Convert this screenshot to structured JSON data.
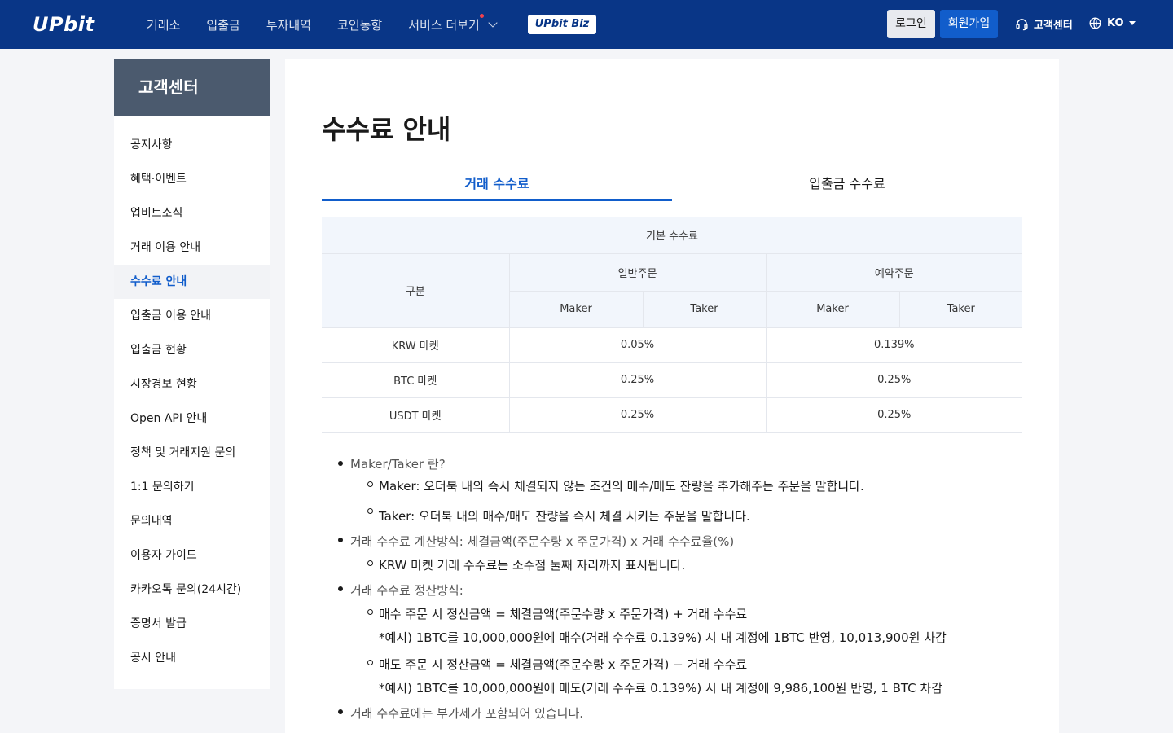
{
  "header": {
    "logo": "UPbit",
    "nav": [
      {
        "label": "거래소"
      },
      {
        "label": "입출금"
      },
      {
        "label": "투자내역"
      },
      {
        "label": "코인동향"
      },
      {
        "label": "서비스 더보기"
      }
    ],
    "biz_badge": "UPbit Biz",
    "login": "로그인",
    "signup": "회원가입",
    "customer_center": "고객센터",
    "language": "KO",
    "colors": {
      "header_bg": "#093687",
      "accent": "#115dcb",
      "new_dot": "#f0414e"
    }
  },
  "sidebar": {
    "title": "고객센터",
    "items": [
      {
        "label": "공지사항"
      },
      {
        "label": "혜택·이벤트"
      },
      {
        "label": "업비트소식"
      },
      {
        "label": "거래 이용 안내"
      },
      {
        "label": "수수료 안내",
        "active": true
      },
      {
        "label": "입출금 이용 안내"
      },
      {
        "label": "입출금 현황"
      },
      {
        "label": "시장경보 현황"
      },
      {
        "label": "Open API 안내"
      },
      {
        "label": "정책 및 거래지원 문의"
      },
      {
        "label": "1:1 문의하기"
      },
      {
        "label": "문의내역"
      },
      {
        "label": "이용자 가이드"
      },
      {
        "label": "카카오톡 문의(24시간)"
      },
      {
        "label": "증명서 발급"
      },
      {
        "label": "공시 안내"
      }
    ]
  },
  "main": {
    "title": "수수료 안내",
    "tabs": [
      {
        "label": "거래 수수료",
        "active": true
      },
      {
        "label": "입출금 수수료"
      }
    ],
    "table": {
      "caption": "기본 수수료",
      "row_header": "구분",
      "group_normal": "일반주문",
      "group_reserved": "예약주문",
      "maker": "Maker",
      "taker": "Taker",
      "rows": [
        {
          "market": "KRW 마켓",
          "normal": "0.05%",
          "reserved": "0.139%"
        },
        {
          "market": "BTC 마켓",
          "normal": "0.25%",
          "reserved": "0.25%"
        },
        {
          "market": "USDT 마켓",
          "normal": "0.25%",
          "reserved": "0.25%"
        }
      ]
    },
    "notes": {
      "maker_taker_title": "Maker/Taker 란?",
      "maker_desc": "Maker: 오더북 내의 즉시 체결되지 않는 조건의 매수/매도 잔량을 추가해주는 주문을 말합니다.",
      "taker_desc": "Taker: 오더북 내의 매수/매도 잔량을 즉시 체결 시키는 주문을 말합니다.",
      "calc_title": "거래 수수료 계산방식: 체결금액(주문수량 x 주문가격) x 거래 수수료율(%)",
      "calc_krw": "KRW 마켓 거래 수수료는 소수점 둘째 자리까지 표시됩니다.",
      "settle_title": "거래 수수료 정산방식:",
      "buy_line": "매수 주문 시 정산금액 = 체결금액(주문수량 x 주문가격) + 거래 수수료",
      "buy_example": "*예시) 1BTC를 10,000,000원에 매수(거래 수수료 0.139%) 시 내 계정에 1BTC 반영, 10,013,900원 차감",
      "sell_line": "매도 주문 시 정산금액 = 체결금액(주문수량 x 주문가격) − 거래 수수료",
      "sell_example": "*예시) 1BTC를 10,000,000원에 매도(거래 수수료 0.139%) 시 내 계정에 9,986,100원 반영, 1 BTC 차감",
      "vat": "거래 수수료에는 부가세가 포함되어 있습니다."
    }
  }
}
